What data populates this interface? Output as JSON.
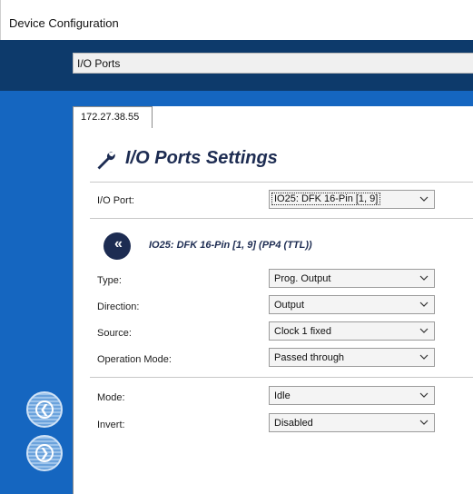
{
  "window": {
    "title": "Device Configuration"
  },
  "breadcrumb": {
    "text": "I/O Ports"
  },
  "tab": {
    "label": "172.27.38.55"
  },
  "heading": {
    "title": "I/O Ports Settings",
    "icon": "wrench-icon"
  },
  "io_port": {
    "label": "I/O Port:",
    "selected": "IO25: DFK 16-Pin [1, 9]"
  },
  "port_section": {
    "back_glyph": "«",
    "title": "IO25: DFK 16-Pin [1, 9] (PP4 (TTL))"
  },
  "fields": [
    {
      "label": "Type:",
      "value": "Prog. Output"
    },
    {
      "label": "Direction:",
      "value": "Output"
    },
    {
      "label": "Source:",
      "value": "Clock 1 fixed"
    },
    {
      "label": "Operation Mode:",
      "value": "Passed through"
    },
    {
      "label": "Mode:",
      "value": "Idle"
    },
    {
      "label": "Invert:",
      "value": "Disabled"
    }
  ],
  "nav": {
    "back_glyph": "❮",
    "forward_glyph": "❯"
  },
  "colors": {
    "navy": "#0d3a6b",
    "sidebar_blue": "#1566c0",
    "heading_navy": "#1d2c52"
  }
}
